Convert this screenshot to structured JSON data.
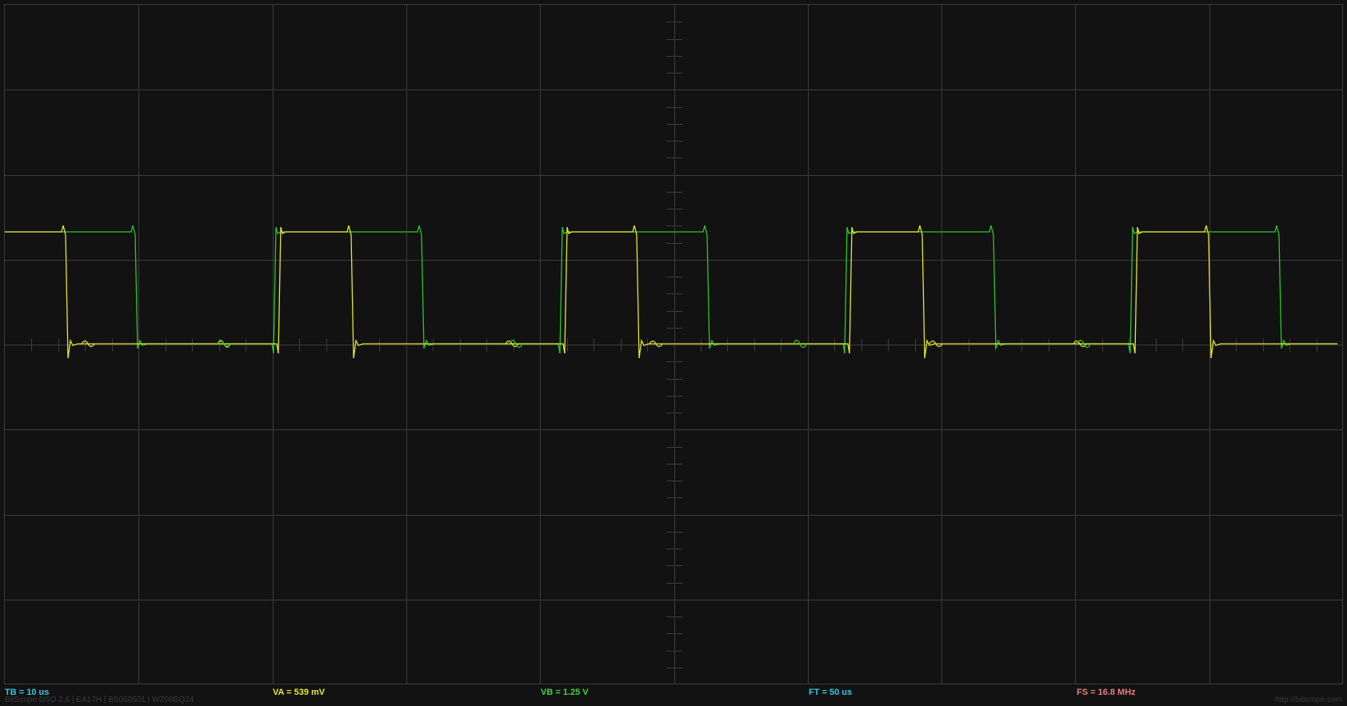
{
  "readouts": {
    "tb": "TB = 10 us",
    "va": "VA = 539 mV",
    "vb": "VB = 1.25 V",
    "ft": "FT = 50 us",
    "fs": "FS = 16.8 MHz"
  },
  "footer": {
    "left": "BitScope DSO 2.6 | EA17H | BS000501 | WZ08BQ24",
    "right": "http://bitscope.com"
  },
  "colors": {
    "background": "#121212",
    "grid": "#3c3c3c",
    "channel_a": "#e6e633",
    "channel_b": "#2ec42e",
    "tb_label": "#34c6e6",
    "va_label": "#e6e633",
    "vb_label": "#3fd43f",
    "ft_label": "#34c6e6",
    "fs_label": "#e67f7f"
  },
  "icons": {
    "trace-a": "yellow-waveform",
    "trace-b": "green-waveform"
  }
}
